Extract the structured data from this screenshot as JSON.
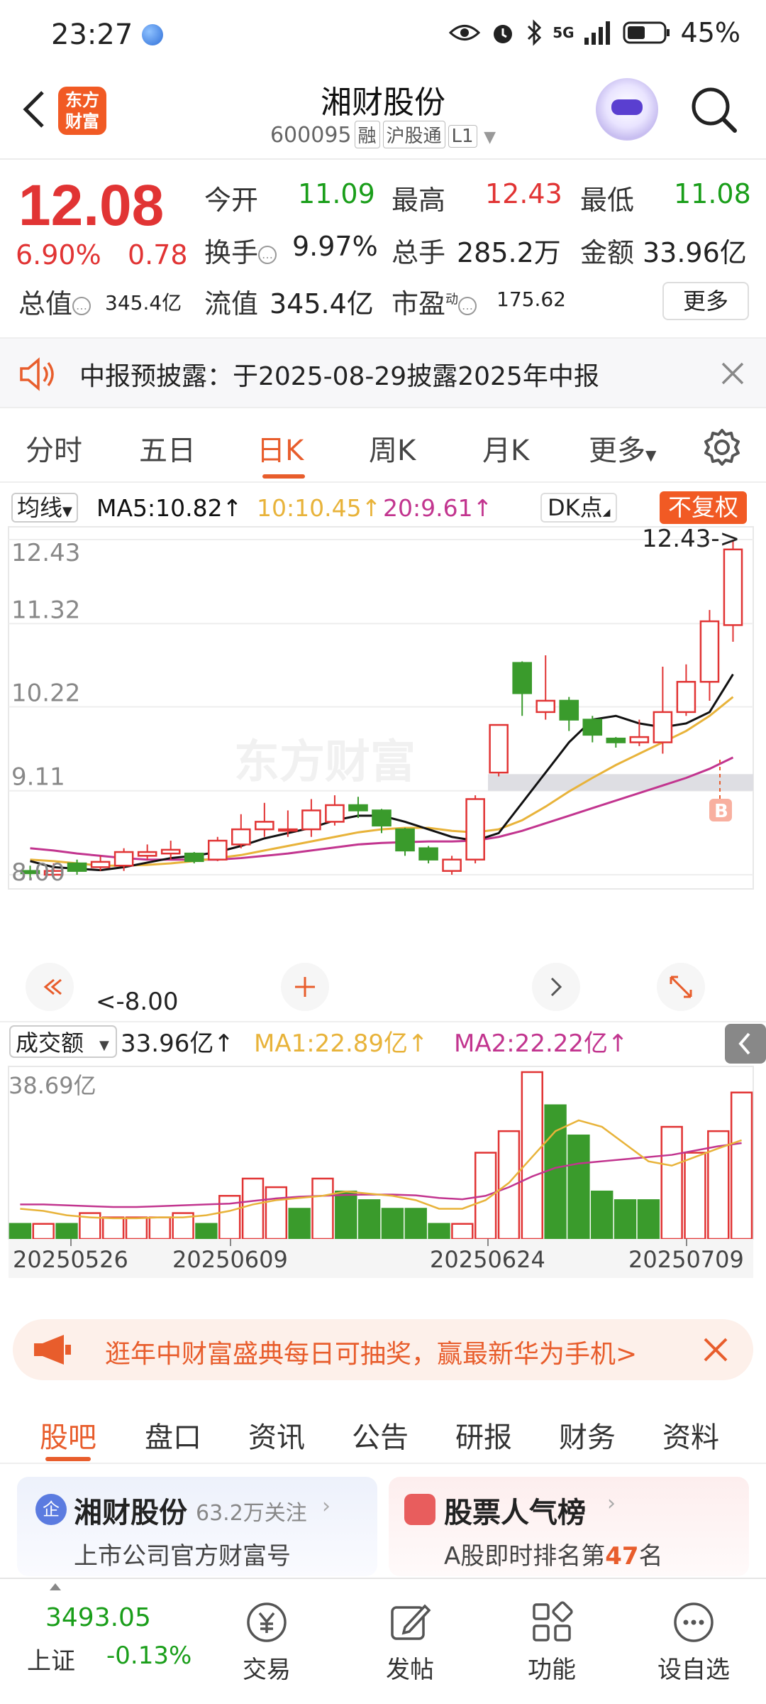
{
  "status": {
    "time": "23:27",
    "battery": "45%",
    "network": "5G"
  },
  "header": {
    "logo_text": "东方财富",
    "title": "湘财股份",
    "code": "600095",
    "tags": [
      "融",
      "沪股通",
      "L1"
    ]
  },
  "quote": {
    "price": "12.08",
    "change_pct": "6.90%",
    "change": "0.78",
    "open_label": "今开",
    "open": "11.09",
    "high_label": "最高",
    "high": "12.43",
    "low_label": "最低",
    "low": "11.08",
    "turnover_label": "换手",
    "turnover": "9.97%",
    "volume_label": "总手",
    "volume": "285.2万",
    "amount_label": "金额",
    "amount": "33.96亿",
    "mktcap_label": "总值",
    "mktcap": "345.4亿",
    "float_label": "流值",
    "float": "345.4亿",
    "pe_label": "市盈",
    "pe_sup": "动",
    "pe": "175.62",
    "more": "更多"
  },
  "notice": {
    "text": "中报预披露：于2025-08-29披露2025年中报"
  },
  "tabs": [
    "分时",
    "五日",
    "日K",
    "周K",
    "月K",
    "更多"
  ],
  "active_tab": "日K",
  "ma_bar": {
    "avg_label": "均线",
    "ma5": "MA5:10.82↑",
    "ma10": "10:10.45↑",
    "ma20": "20:9.61↑",
    "dk": "DK点",
    "adjust": "不复权",
    "colors": {
      "ma5": "#111111",
      "ma10": "#e8b33a",
      "ma20": "#c2358f",
      "up": "#e13434",
      "down": "#3a9b2c"
    }
  },
  "chart_data": [
    {
      "type": "candlestick",
      "y_labels": [
        "12.43",
        "11.32",
        "10.22",
        "9.11",
        "8.00"
      ],
      "ylim": [
        8.0,
        12.43
      ],
      "high_annotation": "12.43->",
      "low_annotation": "<-8.00",
      "watermark": "东方财富",
      "candles": [
        {
          "o": 8.05,
          "c": 8.02,
          "h": 8.12,
          "l": 7.95
        },
        {
          "o": 8.0,
          "c": 8.05,
          "h": 8.15,
          "l": 7.95
        },
        {
          "o": 8.15,
          "c": 8.05,
          "h": 8.2,
          "l": 8.0
        },
        {
          "o": 8.1,
          "c": 8.17,
          "h": 8.25,
          "l": 8.05
        },
        {
          "o": 8.12,
          "c": 8.3,
          "h": 8.35,
          "l": 8.05
        },
        {
          "o": 8.25,
          "c": 8.3,
          "h": 8.4,
          "l": 8.2
        },
        {
          "o": 8.28,
          "c": 8.33,
          "h": 8.45,
          "l": 8.2
        },
        {
          "o": 8.28,
          "c": 8.18,
          "h": 8.3,
          "l": 8.15
        },
        {
          "o": 8.2,
          "c": 8.45,
          "h": 8.5,
          "l": 8.18
        },
        {
          "o": 8.4,
          "c": 8.6,
          "h": 8.8,
          "l": 8.35
        },
        {
          "o": 8.6,
          "c": 8.7,
          "h": 8.95,
          "l": 8.5
        },
        {
          "o": 8.6,
          "c": 8.6,
          "h": 8.85,
          "l": 8.5
        },
        {
          "o": 8.6,
          "c": 8.85,
          "h": 9.0,
          "l": 8.5
        },
        {
          "o": 8.7,
          "c": 8.92,
          "h": 9.05,
          "l": 8.65
        },
        {
          "o": 8.92,
          "c": 8.85,
          "h": 9.03,
          "l": 8.75
        },
        {
          "o": 8.85,
          "c": 8.65,
          "h": 8.87,
          "l": 8.55
        },
        {
          "o": 8.6,
          "c": 8.32,
          "h": 8.62,
          "l": 8.25
        },
        {
          "o": 8.35,
          "c": 8.2,
          "h": 8.38,
          "l": 8.15
        },
        {
          "o": 8.05,
          "c": 8.2,
          "h": 8.25,
          "l": 8.0
        },
        {
          "o": 8.2,
          "c": 9.0,
          "h": 9.05,
          "l": 8.15
        },
        {
          "o": 9.35,
          "c": 9.98,
          "h": 9.98,
          "l": 9.3
        },
        {
          "o": 10.8,
          "c": 10.4,
          "h": 10.82,
          "l": 10.1
        },
        {
          "o": 10.15,
          "c": 10.3,
          "h": 10.9,
          "l": 10.05
        },
        {
          "o": 10.3,
          "c": 10.05,
          "h": 10.35,
          "l": 9.9
        },
        {
          "o": 10.05,
          "c": 9.85,
          "h": 10.1,
          "l": 9.75
        },
        {
          "o": 9.8,
          "c": 9.75,
          "h": 9.82,
          "l": 9.68
        },
        {
          "o": 9.75,
          "c": 9.82,
          "h": 10.05,
          "l": 9.7
        },
        {
          "o": 9.75,
          "c": 10.15,
          "h": 10.75,
          "l": 9.6
        },
        {
          "o": 10.15,
          "c": 10.55,
          "h": 10.78,
          "l": 10.1
        },
        {
          "o": 10.55,
          "c": 11.35,
          "h": 11.5,
          "l": 10.3
        },
        {
          "o": 11.3,
          "c": 12.3,
          "h": 12.43,
          "l": 11.08
        }
      ],
      "ma5": [
        8.18,
        8.1,
        8.08,
        8.06,
        8.1,
        8.16,
        8.22,
        8.25,
        8.3,
        8.38,
        8.48,
        8.55,
        8.62,
        8.72,
        8.78,
        8.78,
        8.7,
        8.6,
        8.5,
        8.45,
        8.55,
        8.95,
        9.35,
        9.75,
        10.05,
        10.1,
        10.0,
        9.95,
        10.0,
        10.15,
        10.65
      ],
      "ma10": [
        8.2,
        8.18,
        8.15,
        8.12,
        8.12,
        8.13,
        8.15,
        8.18,
        8.22,
        8.26,
        8.32,
        8.38,
        8.44,
        8.5,
        8.56,
        8.6,
        8.62,
        8.62,
        8.58,
        8.56,
        8.6,
        8.72,
        8.9,
        9.1,
        9.28,
        9.45,
        9.6,
        9.75,
        9.9,
        10.1,
        10.35
      ],
      "ma20": [
        8.35,
        8.32,
        8.28,
        8.25,
        8.22,
        8.2,
        8.2,
        8.2,
        8.2,
        8.22,
        8.25,
        8.28,
        8.32,
        8.36,
        8.4,
        8.42,
        8.43,
        8.44,
        8.44,
        8.45,
        8.5,
        8.58,
        8.68,
        8.78,
        8.88,
        8.98,
        9.08,
        9.18,
        9.28,
        9.4,
        9.55
      ],
      "box_zone": [
        9.11,
        9.33
      ]
    },
    {
      "type": "bar",
      "label": "成交额",
      "total": "33.96亿↑",
      "ma1": "MA1:22.89亿↑",
      "ma2": "MA2:22.22亿↑",
      "y_label": "38.69亿",
      "ylim": [
        0,
        38.69
      ],
      "x_labels": [
        "20250526",
        "20250609",
        "20250624",
        "20250709"
      ],
      "values": [
        3.5,
        3.5,
        3.5,
        6,
        5,
        5,
        5,
        6,
        3.5,
        10,
        14,
        12,
        7,
        14,
        11,
        9,
        7,
        7,
        3.5,
        3.5,
        20,
        25,
        38.69,
        31,
        24,
        11,
        9,
        9,
        26,
        20,
        25,
        33.96
      ],
      "up": [
        false,
        true,
        false,
        true,
        true,
        true,
        true,
        true,
        false,
        true,
        true,
        true,
        false,
        true,
        false,
        false,
        false,
        false,
        false,
        true,
        true,
        true,
        true,
        false,
        false,
        false,
        false,
        false,
        true,
        true,
        true,
        true
      ],
      "ma1_line": [
        7,
        6.5,
        5.5,
        5,
        4.8,
        4.8,
        5,
        5,
        5.5,
        6.5,
        8,
        9,
        9.5,
        10,
        11,
        10.5,
        10,
        9,
        7,
        7,
        9,
        13,
        19,
        25,
        27.5,
        26,
        22,
        18,
        17,
        19,
        21,
        22.89
      ],
      "ma2_line": [
        8,
        8,
        7.8,
        7.6,
        7.4,
        7.4,
        7.6,
        7.8,
        8,
        8.2,
        8.8,
        9.4,
        9.8,
        10,
        10.2,
        10.3,
        10.3,
        10.1,
        9.5,
        9.2,
        10,
        12,
        14.5,
        16.5,
        17.5,
        18,
        18.5,
        19,
        19.5,
        20.5,
        21.5,
        22.22
      ]
    }
  ],
  "ad": {
    "text": "逛年中财富盛典每日可抽奖，赢最新华为手机>"
  },
  "subtabs": [
    "股吧",
    "盘口",
    "资讯",
    "公告",
    "研报",
    "财务",
    "资料"
  ],
  "cards": {
    "left_title": "湘财股份",
    "left_follow": "63.2万关注",
    "left_sub": "上市公司官方财富号",
    "left_badge": "企",
    "right_title": "股票人气榜",
    "right_sub_prefix": "A股即时排名第",
    "right_rank": "47",
    "right_sub_suffix": "名"
  },
  "bottom": {
    "index_value": "3493.05",
    "index_name": "上证",
    "index_change": "-0.13%",
    "items": [
      "交易",
      "发帖",
      "功能",
      "设自选"
    ]
  }
}
